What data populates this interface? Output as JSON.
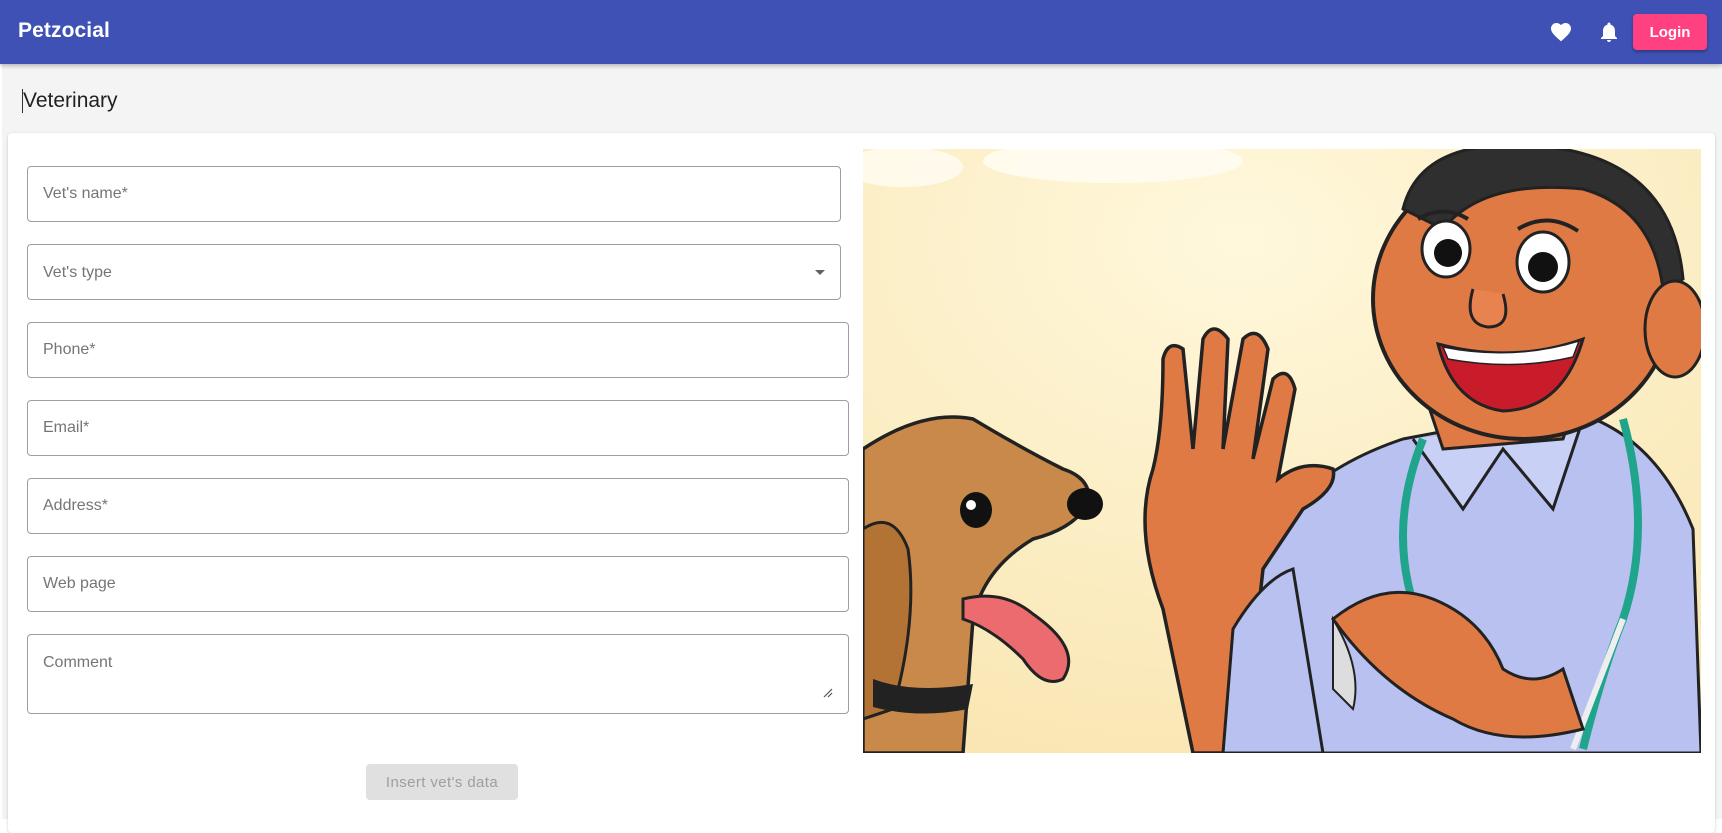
{
  "app": {
    "title": "Petzocial",
    "favorites_icon": "heart-icon",
    "notifications_icon": "bell-icon",
    "login_label": "Login",
    "colors": {
      "appbar": "#3f51b5",
      "accent": "#ff4081"
    }
  },
  "page": {
    "title": "Veterinary"
  },
  "form": {
    "vet_name": {
      "placeholder": "Vet's name*",
      "value": ""
    },
    "vet_type": {
      "label": "Vet's type",
      "value": ""
    },
    "phone": {
      "placeholder": "Phone*",
      "value": ""
    },
    "email": {
      "placeholder": "Email*",
      "value": ""
    },
    "address": {
      "placeholder": "Address*",
      "value": ""
    },
    "web_page": {
      "placeholder": "Web page",
      "value": ""
    },
    "comment": {
      "placeholder": "Comment",
      "value": ""
    },
    "submit_label": "Insert vet's data"
  },
  "illustration": {
    "icon": "vet-with-dog-illustration"
  }
}
